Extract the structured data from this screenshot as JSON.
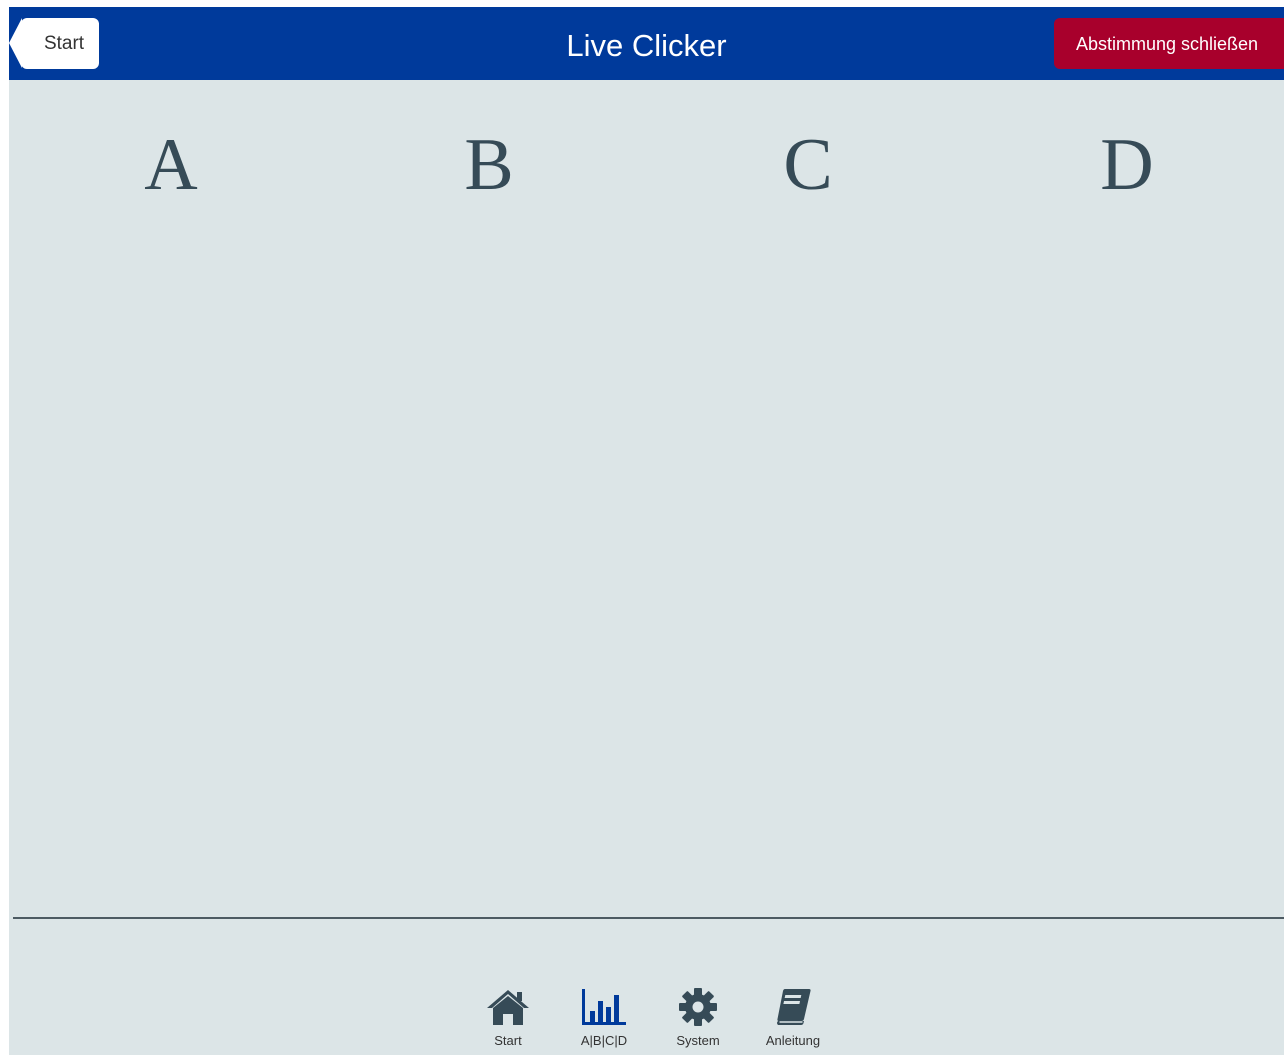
{
  "header": {
    "back_label": "Start",
    "title": "Live Clicker",
    "close_label": "Abstimmung schließen"
  },
  "answers": [
    "A",
    "B",
    "C",
    "D"
  ],
  "footer": {
    "items": [
      {
        "label": "Start",
        "icon": "home-icon"
      },
      {
        "label": "A|B|C|D",
        "icon": "bar-chart-icon"
      },
      {
        "label": "System",
        "icon": "gear-icon"
      },
      {
        "label": "Anleitung",
        "icon": "book-icon"
      }
    ]
  },
  "colors": {
    "header_bg": "#003a9b",
    "close_button_bg": "#a8002c",
    "content_bg": "#dce5e7",
    "answer_text": "#364b57",
    "active_nav_icon": "#003a9b",
    "nav_icon": "#364b57"
  }
}
